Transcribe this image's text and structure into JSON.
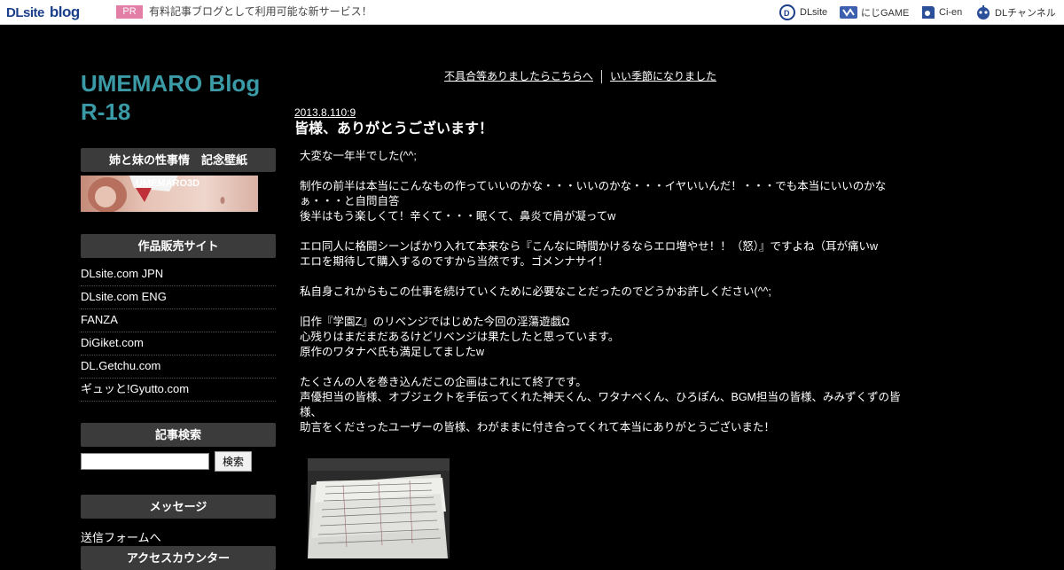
{
  "header": {
    "logo_dl": "DLsite",
    "logo_blog": "blog",
    "pr_badge": "PR",
    "pr_text": "有料記事ブログとして利用可能な新サービス！",
    "services": [
      {
        "label": "DLsite",
        "icon": "dlsite-icon"
      },
      {
        "label": "にじGAME",
        "icon": "nijigame-icon"
      },
      {
        "label": "Ci-en",
        "icon": "ci-en-icon"
      },
      {
        "label": "DLチャンネル",
        "icon": "dl-channel-icon"
      }
    ]
  },
  "sidebar": {
    "blog_title_line1": "UMEMARO Blog",
    "blog_title_line2": "R-18",
    "wallpaper_heading": "姉と妹の性事情　記念壁紙",
    "banner_text": "UMEMARO3D",
    "sites_heading": "作品販売サイト",
    "sites": [
      "DLsite.com JPN",
      "DLsite.com ENG",
      "FANZA",
      "DiGiket.com",
      "DL.Getchu.com",
      "ギュッと!Gyutto.com"
    ],
    "search_heading": "記事検索",
    "search_value": "",
    "search_button": "検索",
    "message_heading": "メッセージ",
    "message_link": "送信フォームへ",
    "counter_heading": "アクセスカウンター"
  },
  "nav": {
    "link1": "不具合等ありましたらこちらへ",
    "link2": "いい季節になりました"
  },
  "post": {
    "date": "2013.8.110:9",
    "title": "皆様、ありがとうございます！",
    "paragraphs": [
      "大変な一年半でした(^^;",
      "制作の前半は本当にこんなもの作っていいのかな・・・いいのかな・・・イヤいいんだ！・・・でも本当にいいのかなぁ・・・と自問自答\n後半はもう楽しくて！辛くて・・・眠くて、鼻炎で肩が凝ってw",
      "エロ同人に格闘シーンばかり入れて本来なら『こんなに時間かけるならエロ増やせ！！（怒）』ですよね（耳が痛いw\nエロを期待して購入するのですから当然です。ゴメンナサイ！",
      "私自身これからもこの仕事を続けていくために必要なことだったのでどうかお許しください(^^;",
      "旧作『学園Z』のリベンジではじめた今回の淫蕩遊戯Ω\n心残りはまだまだあるけどリベンジは果たしたと思っています。\n原作のワタナベ氏も満足してましたw",
      "たくさんの人を巻き込んだこの企画はこれにて終了です。\n声優担当の皆様、オブジェクトを手伝ってくれた神天くん、ワタナベくん、ひろぽん、BGM担当の皆様、みみずくずの皆様、\n助言をくださったユーザーの皆様、わがままに付き合ってくれて本当にありがとうございまた！"
    ]
  },
  "colors": {
    "background": "#000000",
    "title_accent": "#3a9aa6",
    "sidebar_heading_bg": "#3b3b3b",
    "pr_badge": "#e37fa7"
  }
}
